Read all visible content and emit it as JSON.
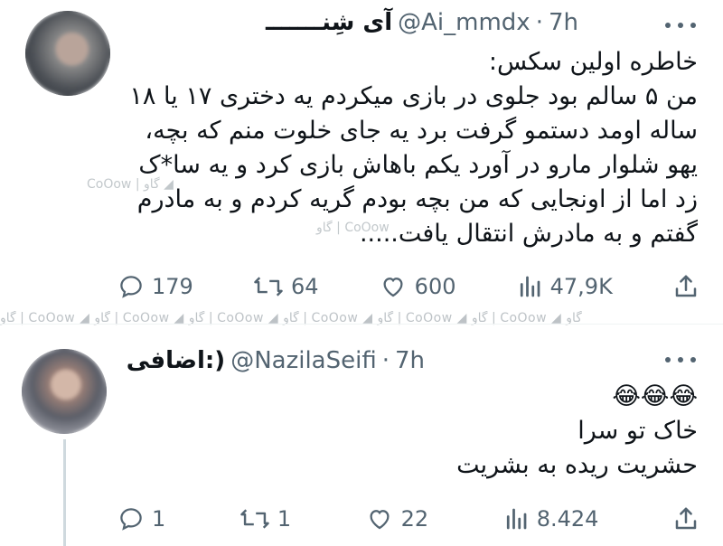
{
  "tweet1": {
    "name": "آی شِنـــــــ",
    "handle": "@Ai_mmdx",
    "sep": "·",
    "time": "7h",
    "lines": [
      "خاطره اولین سکس:",
      "من ۵ سالم بود جلوی در بازی میکردم یه دختری ۱۷ یا ۱۸",
      "ساله اومد دستمو گرفت برد یه جای خلوت منم که بچه،",
      "یهو شلوار مارو در آورد یکم باهاش بازی کرد و یه سا*ک",
      "زد اما از اونجایی که من بچه بودم گریه کردم و به مادرم",
      "گفتم و به مادرش انتقال یافت....."
    ],
    "actions": {
      "replies": "179",
      "retweets": "64",
      "likes": "600",
      "views": "47,9K"
    }
  },
  "tweet2": {
    "name": "اضافی:)",
    "handle": "@NazilaSeifi",
    "sep": "·",
    "time": "7h",
    "lines": [
      "😂😂😂",
      "خاک تو سرا",
      "حشریت ریده به بشریت"
    ],
    "actions": {
      "replies": "1",
      "retweets": "1",
      "likes": "22",
      "views": "8.424"
    }
  },
  "watermark": {
    "strip": "گاو | CoOow ◢ گاو | CoOow ◢ گاو | CoOow ◢ گاو | CoOow ◢ گاو | CoOow ◢ گاو | CoOow ◢ گاو",
    "mark1": "CoOow | گاو ◢",
    "mark2": "گاو | CoOow"
  },
  "icons": [
    "reply-icon",
    "retweet-icon",
    "like-icon",
    "views-icon",
    "share-icon",
    "more-icon"
  ],
  "colors": {
    "text": "#0f1419",
    "muted": "#536471",
    "divider": "#eff3f4"
  }
}
